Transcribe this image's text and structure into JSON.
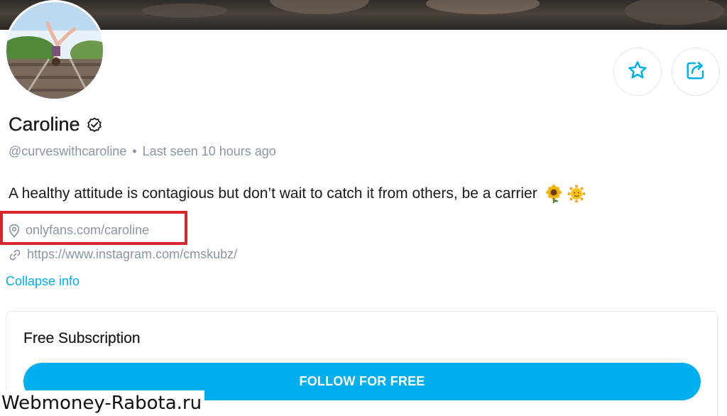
{
  "profile": {
    "name": "Caroline",
    "handle": "@curveswithcaroline",
    "separator": "•",
    "last_seen": "Last seen 10 hours ago",
    "bio": "A healthy attitude is contagious but don’t wait to catch it from others, be a carrier",
    "bio_emojis": [
      "sunflower-emoji",
      "sun-with-face-emoji"
    ],
    "location": "onlyfans.com/caroline",
    "website": "https://www.instagram.com/cmskubz/",
    "collapse_label": "Collapse info"
  },
  "actions": {
    "favorite_icon": "star-icon",
    "share_icon": "share-icon"
  },
  "subscription": {
    "title": "Free Subscription",
    "button_label": "FOLLOW FOR FREE"
  },
  "watermark": "Webmoney-Rabota.ru",
  "colors": {
    "accent": "#00aff0",
    "muted_text": "#8a96a3",
    "highlight": "#d9262c"
  }
}
